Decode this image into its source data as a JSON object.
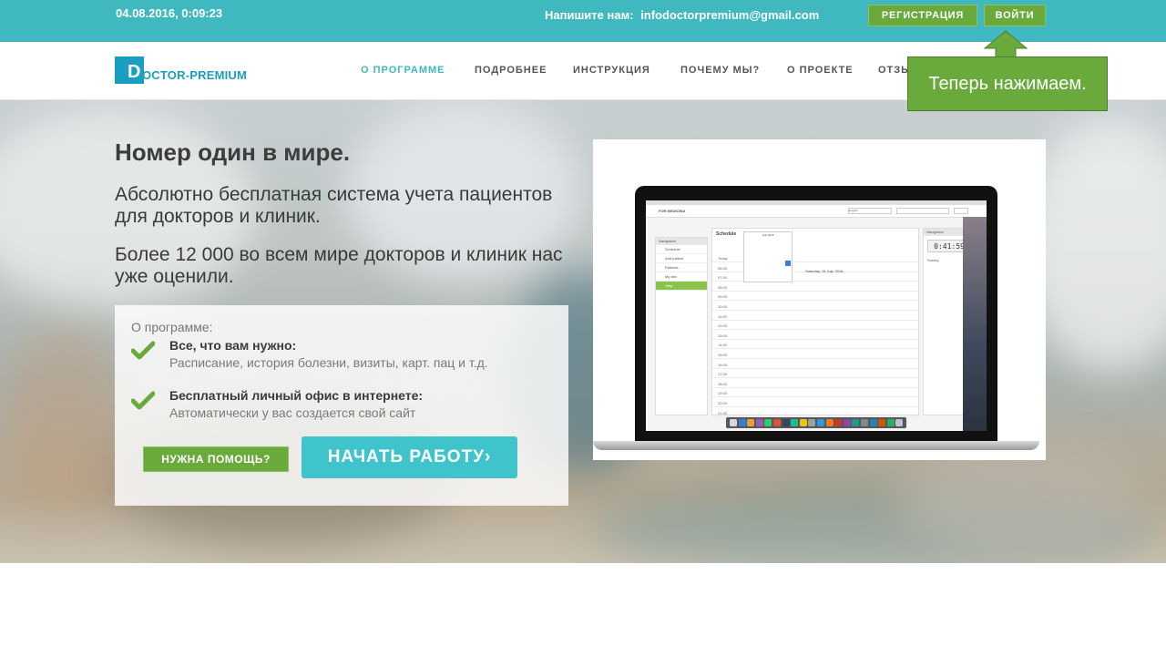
{
  "topbar": {
    "datetime": "04.08.2016, 0:09:23",
    "contact_label": "Напишите нам:",
    "contact_email": "infodoctorpremium@gmail.com",
    "register_label": "РЕГИСТРАЦИЯ",
    "login_label": "ВОЙТИ"
  },
  "logo": {
    "letter": "D",
    "text": "OCTOR-PREMIUM"
  },
  "nav": {
    "items": [
      "О ПРОГРАММЕ",
      "ПОДРОБНЕЕ",
      "ИНСТРУКЦИЯ",
      "ПОЧЕМУ МЫ?",
      "О ПРОЕКТЕ",
      "ОТЗЫ"
    ],
    "active_index": 0
  },
  "hero": {
    "title": "Номер один в мире.",
    "subtitle1": "Абсолютно бесплатная система учета пациентов для докторов и клиник.",
    "subtitle2": "Более 12 000 во всем мире докторов и клиник нас уже оценили."
  },
  "about_panel": {
    "label": "О программе:",
    "features": [
      {
        "title": "Все, что вам нужно:",
        "desc": "Расписание, история болезни, визиты, карт. пац и т.д."
      },
      {
        "title": "Бесплатный личный офис в интернете:",
        "desc": "Автоматически у вас создается свой сайт"
      }
    ],
    "help_label": "НУЖНА ПОМОЩЬ?",
    "start_label": "НАЧАТЬ РАБОТУ›"
  },
  "app_screenshot": {
    "brand": "FOR MEDICINA",
    "language": "English",
    "left_panel_title": "Navigation",
    "left_items": [
      "Schedule",
      "Add patient",
      "Patients",
      "My site",
      "Help"
    ],
    "active_left_index": 4,
    "schedule_title": "Schedule",
    "calendar_month": "July 2016",
    "date_label": "Saturday, 16 July, 2016",
    "times": [
      "Today",
      "06:00",
      "07:00",
      "08:00",
      "09:00",
      "10:00",
      "11:00",
      "12:00",
      "13:00",
      "14:00",
      "15:00",
      "16:00",
      "17:00",
      "18:00",
      "19:00",
      "20:00",
      "21:00"
    ],
    "right_panel_title": "Navigation",
    "clock": "0:41:59",
    "right_item": "Survey"
  },
  "callout": {
    "text": "Теперь нажимаем."
  },
  "colors": {
    "teal": "#3fb8c0",
    "green": "#6aa93b",
    "start_button": "#40c4cc",
    "logo_blue": "#1a9fc0"
  }
}
